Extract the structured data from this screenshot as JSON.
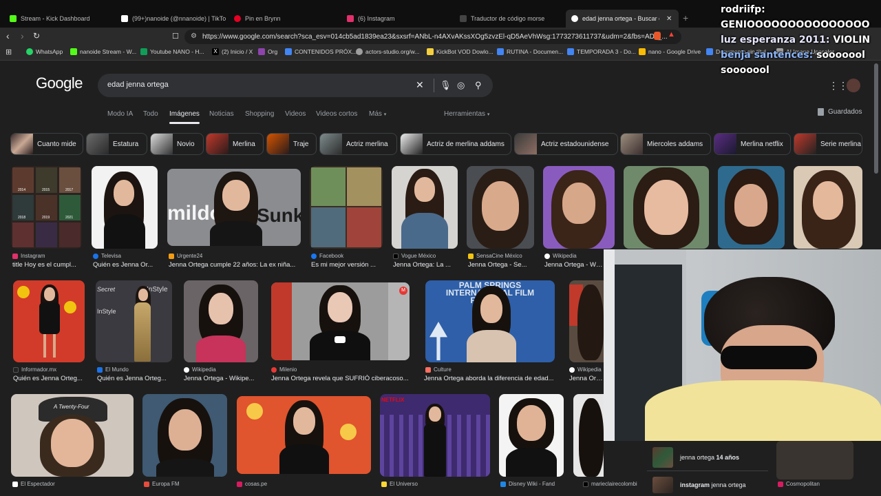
{
  "browser": {
    "tabs": [
      {
        "title": "Stream - Kick Dashboard",
        "color": "#53fc18"
      },
      {
        "title": "(99+)nanoide (@nnanoide) | TikTok",
        "color": "#ffffff"
      },
      {
        "title": "Pin en Brynn",
        "color": "#e60023"
      },
      {
        "title": "(6) Instagram",
        "color": "#e1306c"
      },
      {
        "title": "Traductor de código morse",
        "color": "#444444"
      },
      {
        "title": "edad jenna ortega - Buscar con",
        "color": "#ffffff",
        "active": true
      }
    ],
    "url": "https://www.google.com/search?sca_esv=014cb5ad1839ea23&sxsrf=ANbL-n4AXvAKssXOg5zvzEl-qD5AeVhWsg:1773273611737&udm=2&fbs=ADc_...",
    "bookmarks": [
      {
        "label": "WhatsApp",
        "color": "#25d366"
      },
      {
        "label": "nanoide Stream - W...",
        "color": "#53fc18"
      },
      {
        "label": "Youtube NANO - H...",
        "color": "#0f9d58"
      },
      {
        "label": "(2) Inicio / X",
        "color": "#000000"
      },
      {
        "label": "Org",
        "color": "#8e44ad"
      },
      {
        "label": "CONTENIDOS PRÓX...",
        "color": "#4285f4"
      },
      {
        "label": "actors-studio.org/w...",
        "color": "#9e9e9e"
      },
      {
        "label": "KickBot VOD Dowlo...",
        "color": "#f4d03f"
      },
      {
        "label": "RUTINA - Documen...",
        "color": "#4285f4"
      },
      {
        "label": "TEMPORADA 3 - Do...",
        "color": "#4285f4"
      },
      {
        "label": "nano - Google Drive",
        "color": "#fbbc04"
      },
      {
        "label": "Documento sin títul",
        "color": "#4285f4"
      },
      {
        "label": "AI Image Upscaler",
        "color": "#9e9e9e"
      }
    ]
  },
  "google": {
    "logo": "Google",
    "query": "edad jenna ortega",
    "nav_tabs": [
      "Modo IA",
      "Todo",
      "Imágenes",
      "Noticias",
      "Shopping",
      "Videos",
      "Videos cortos",
      "Más"
    ],
    "active_tab": "Imágenes",
    "tools": "Herramientas",
    "saved": "Guardados",
    "chips": [
      "Cuanto mide",
      "Estatura",
      "Novio",
      "Merlina",
      "Traje",
      "Actriz merlina",
      "Actriz de merlina addams",
      "Actriz estadounidense",
      "Miercoles addams",
      "Merlina netflix",
      "Serie merlina"
    ],
    "row1": [
      {
        "source": "Instagram",
        "title": "title Hoy es el cumpl..."
      },
      {
        "source": "Televisa",
        "title": "Quién es Jenna Or..."
      },
      {
        "source": "Urgente24",
        "title": "Jenna Ortega cumple 22 años: La ex niña..."
      },
      {
        "source": "Facebook",
        "title": "Es mi mejor versión ..."
      },
      {
        "source": "Vogue México",
        "title": "Jenna Ortega: La ..."
      },
      {
        "source": "SensaCine México",
        "title": "Jenna Ortega - Se..."
      },
      {
        "source": "Wikipedia",
        "title": "Jenna Ortega - Wiki..."
      }
    ],
    "row2": [
      {
        "source": "Informador.mx",
        "title": "Quién es Jenna Orteg..."
      },
      {
        "source": "El Mundo",
        "title": "Quién es Jenna Orteg..."
      },
      {
        "source": "Wikipedia",
        "title": "Jenna Ortega - Wikipe..."
      },
      {
        "source": "Milenio",
        "title": "Jenna Ortega revela que SUFRIÓ ciberacoso..."
      },
      {
        "source": "Culture",
        "title": "Jenna Ortega aborda la diferencia de edad..."
      },
      {
        "source": "Wikipedia",
        "title": "Jenna Orteg"
      }
    ],
    "row3": [
      {
        "source": "El Espectador"
      },
      {
        "source": "Europa FM"
      },
      {
        "source": "cosas.pe"
      },
      {
        "source": "El Universo"
      },
      {
        "source": "Disney Wiki - Fand"
      },
      {
        "source": "marieclairecolombi"
      },
      {
        "source": "Cosmopolitan"
      }
    ],
    "image_text": {
      "sunk": "Sunk",
      "mildo": "mildo",
      "hat": "A Twenty-Four",
      "palm_springs": "PALM SPRINGS INTERNATIONAL FILM FESTIVAL",
      "instyle": "InStyle",
      "secret": "Secret",
      "netflix": "NETFLIX",
      "vogue_years": [
        "2014",
        "2015",
        "2017",
        "2018",
        "2019",
        "2021"
      ]
    },
    "side_panel": [
      {
        "text": "jenna ortega ",
        "bold": "14 años"
      },
      {
        "text": "instagram ",
        "bold": "jenna ortega"
      }
    ]
  },
  "stream_chat": [
    {
      "name": "rodriifp:",
      "message": "GENIOOOOOOOOOOOOOOO"
    },
    {
      "name": "luz esperanza 2011:",
      "message": "VIOLIN"
    },
    {
      "name": "benja santences:",
      "message": "sooooool"
    },
    {
      "name": "",
      "message": "sooooool"
    }
  ]
}
